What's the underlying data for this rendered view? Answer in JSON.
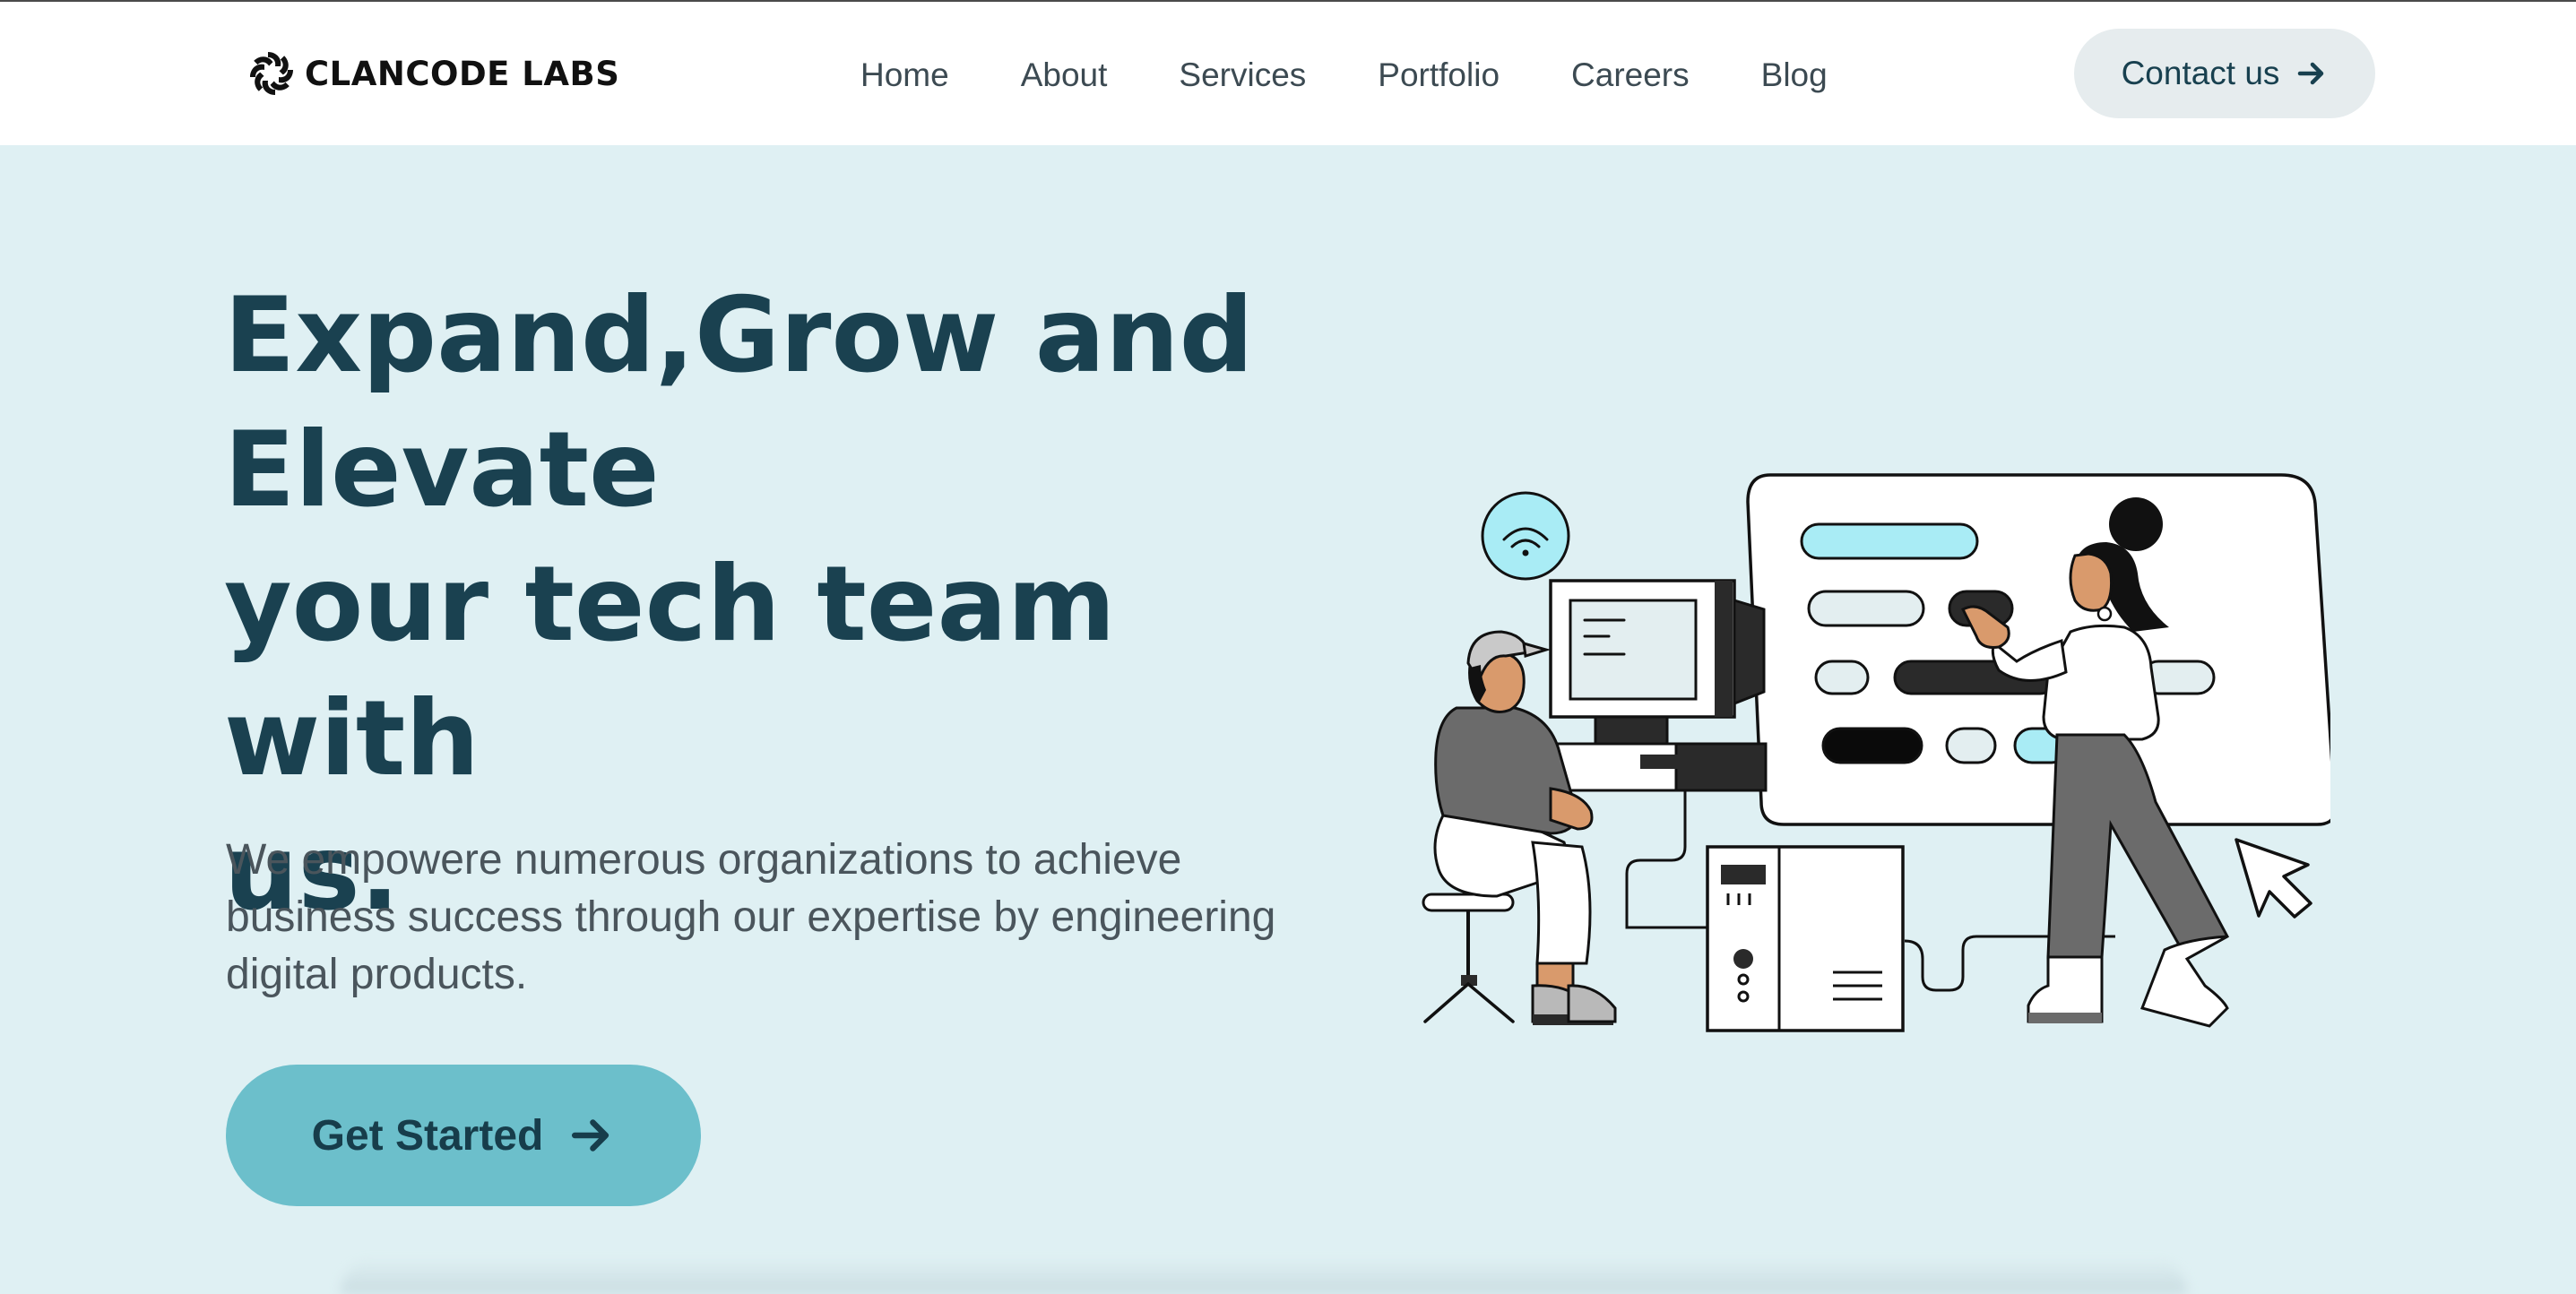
{
  "brand": {
    "name": "CLANCODE LABS",
    "logo_icon": "flower-logo-icon"
  },
  "nav": {
    "items": [
      {
        "label": "Home"
      },
      {
        "label": "About"
      },
      {
        "label": "Services"
      },
      {
        "label": "Portfolio"
      },
      {
        "label": "Careers"
      },
      {
        "label": "Blog"
      }
    ],
    "contact_label": "Contact us",
    "contact_icon": "arrow-right-icon"
  },
  "hero": {
    "title_lines": [
      "Expand,Grow and",
      "Elevate",
      "your tech team with",
      "us."
    ],
    "subtitle": "We empowere numerous organizations to achieve business success through our expertise by engineering digital products.",
    "cta_label": "Get Started",
    "cta_icon": "arrow-right-icon"
  },
  "colors": {
    "background": "#dff0f3",
    "heading": "#1a4150",
    "cta": "#6cbfcb",
    "contact_bg": "#e6ecee",
    "accent_light": "#a9ecf5"
  }
}
